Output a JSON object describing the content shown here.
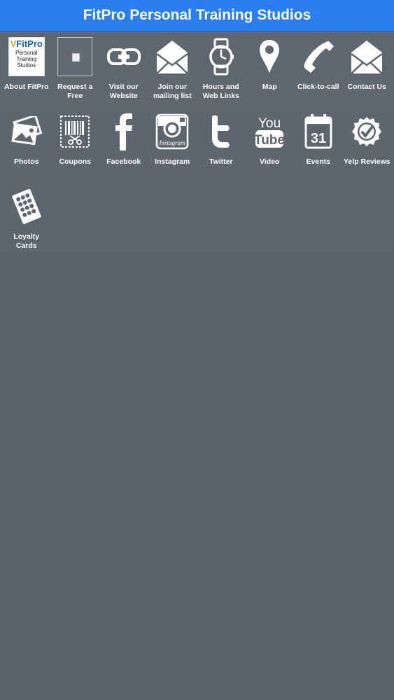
{
  "header": {
    "title": "FitPro Personal Training Studios"
  },
  "logo": {
    "brand": "FitPro",
    "sub1": "Personal",
    "sub2": "Training",
    "sub3": "Studios"
  },
  "tiles": [
    {
      "label": "About FitPro",
      "icon": "fitpro-logo-icon"
    },
    {
      "label": "Request a Free",
      "icon": "broken-image-icon"
    },
    {
      "label": "Visit our Website",
      "icon": "link-chain-icon"
    },
    {
      "label": "Join our mailing list",
      "icon": "envelope-icon"
    },
    {
      "label": "Hours and Web Links",
      "icon": "watch-icon"
    },
    {
      "label": "Map",
      "icon": "map-pin-icon"
    },
    {
      "label": "Click-to-call",
      "icon": "phone-icon"
    },
    {
      "label": "Contact Us",
      "icon": "envelope-icon"
    },
    {
      "label": "Photos",
      "icon": "photos-icon"
    },
    {
      "label": "Coupons",
      "icon": "coupon-icon"
    },
    {
      "label": "Facebook",
      "icon": "facebook-icon"
    },
    {
      "label": "Instagram",
      "icon": "instagram-icon"
    },
    {
      "label": "Twitter",
      "icon": "twitter-icon"
    },
    {
      "label": "Video",
      "icon": "youtube-icon"
    },
    {
      "label": "Events",
      "icon": "calendar-icon"
    },
    {
      "label": "Yelp Reviews",
      "icon": "badge-check-icon"
    },
    {
      "label": "Loyalty Cards",
      "icon": "loyalty-card-icon"
    }
  ],
  "icon_text": {
    "youtube_top": "You",
    "youtube_bottom": "Tube",
    "calendar_day": "31",
    "instagram_word": "Instagram"
  },
  "colors": {
    "header_bg": "#2b7ef0",
    "page_bg": "#5e666e",
    "icon": "#ffffff"
  }
}
